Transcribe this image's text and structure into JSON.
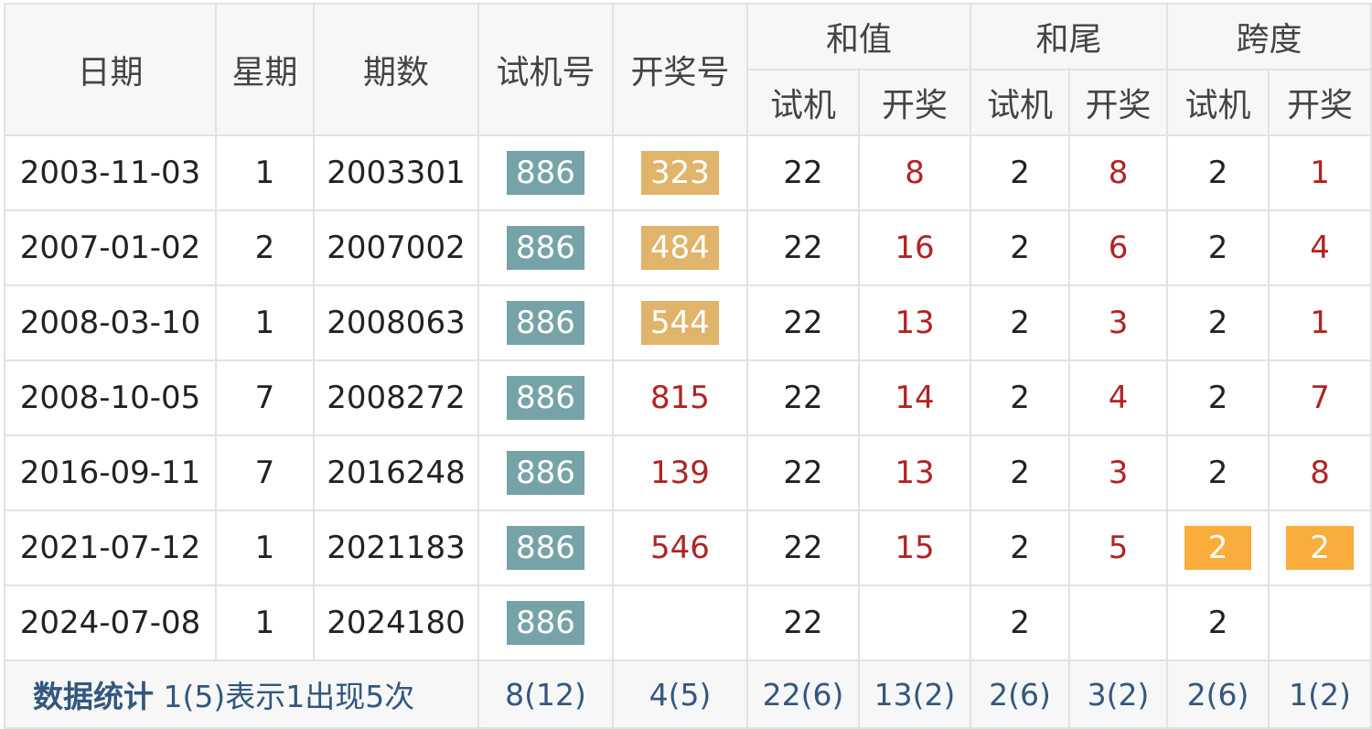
{
  "headers": {
    "date": "日期",
    "weekday": "星期",
    "period": "期数",
    "test_no": "试机号",
    "draw_no": "开奖号",
    "sum": "和值",
    "sum_tail": "和尾",
    "span": "跨度",
    "sub_test": "试机",
    "sub_draw": "开奖"
  },
  "rows": [
    {
      "date": "2003-11-03",
      "weekday": "1",
      "period": "2003301",
      "test": "886",
      "draw": "323",
      "sum_test": "22",
      "sum_draw": "8",
      "tail_test": "2",
      "tail_draw": "8",
      "span_test": "2",
      "span_draw": "1"
    },
    {
      "date": "2007-01-02",
      "weekday": "2",
      "period": "2007002",
      "test": "886",
      "draw": "484",
      "sum_test": "22",
      "sum_draw": "16",
      "tail_test": "2",
      "tail_draw": "6",
      "span_test": "2",
      "span_draw": "4"
    },
    {
      "date": "2008-03-10",
      "weekday": "1",
      "period": "2008063",
      "test": "886",
      "draw": "544",
      "sum_test": "22",
      "sum_draw": "13",
      "tail_test": "2",
      "tail_draw": "3",
      "span_test": "2",
      "span_draw": "1"
    },
    {
      "date": "2008-10-05",
      "weekday": "7",
      "period": "2008272",
      "test": "886",
      "draw": "815",
      "sum_test": "22",
      "sum_draw": "14",
      "tail_test": "2",
      "tail_draw": "4",
      "span_test": "2",
      "span_draw": "7"
    },
    {
      "date": "2016-09-11",
      "weekday": "7",
      "period": "2016248",
      "test": "886",
      "draw": "139",
      "sum_test": "22",
      "sum_draw": "13",
      "tail_test": "2",
      "tail_draw": "3",
      "span_test": "2",
      "span_draw": "8"
    },
    {
      "date": "2021-07-12",
      "weekday": "1",
      "period": "2021183",
      "test": "886",
      "draw": "546",
      "sum_test": "22",
      "sum_draw": "15",
      "tail_test": "2",
      "tail_draw": "5",
      "span_test": "2",
      "span_draw": "2"
    },
    {
      "date": "2024-07-08",
      "weekday": "1",
      "period": "2024180",
      "test": "886",
      "draw": "",
      "sum_test": "22",
      "sum_draw": "",
      "tail_test": "2",
      "tail_draw": "",
      "span_test": "2",
      "span_draw": ""
    }
  ],
  "stats": {
    "label": "数据统计",
    "note": "1(5)表示1出现5次",
    "test": "8(12)",
    "draw": "4(5)",
    "sum_test": "22(6)",
    "sum_draw": "13(2)",
    "tail_test": "2(6)",
    "tail_draw": "3(2)",
    "span_test": "2(6)",
    "span_draw": "1(2)"
  },
  "colors": {
    "test_box": "#76a3a7",
    "draw_box": "#e0b46a",
    "match_box": "#f8ad3c",
    "draw_text": "#b02424",
    "stats_text": "#33577f"
  }
}
